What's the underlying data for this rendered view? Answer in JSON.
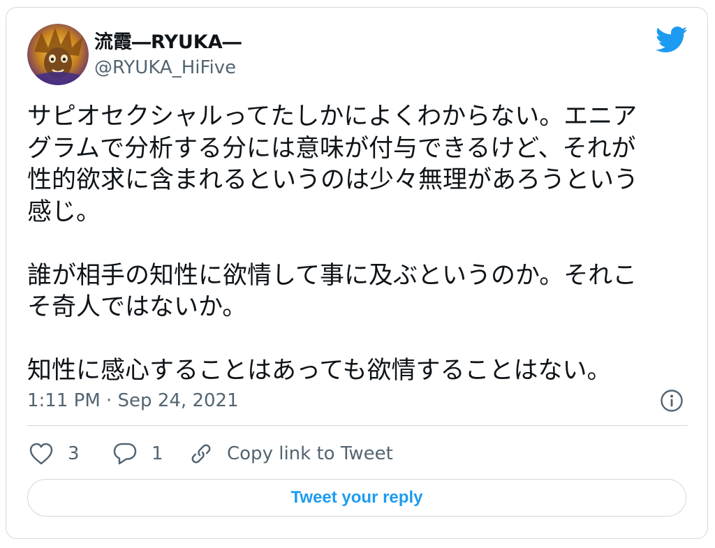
{
  "author": {
    "display_name": "流霞―RYUKA―",
    "handle": "@RYUKA_HiFive"
  },
  "icons": {
    "brand": "twitter-bird-icon",
    "info": "info-icon",
    "like": "heart-icon",
    "reply": "reply-bubble-icon",
    "copy": "link-icon"
  },
  "tweet": {
    "lines": [
      "サピオセクシャルってたしかによくわからない。エニア",
      "グラムで分析する分には意味が付与できるけど、それが",
      "性的欲求に含まれるというのは少々無理があろうという",
      "感じ。",
      "",
      "誰が相手の知性に欲情して事に及ぶというのか。それこ",
      "そ奇人ではないか。",
      "",
      "知性に感心することはあっても欲情することはない。"
    ],
    "timestamp": "1:11 PM · Sep 24, 2021"
  },
  "actions": {
    "likes": "3",
    "replies": "1",
    "copy_label": "Copy link to Tweet"
  },
  "reply_button": {
    "label": "Tweet your reply"
  },
  "colors": {
    "brand": "#1d9bf0",
    "text": "#0f1419",
    "secondary": "#536471",
    "border": "#cfd9de"
  }
}
